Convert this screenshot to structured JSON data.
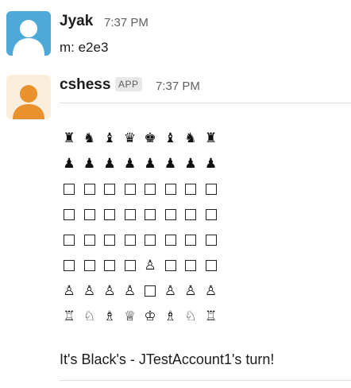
{
  "messages": [
    {
      "author": "Jyak",
      "time": "7:37 PM",
      "text": "m: e2e3",
      "avatar_color": "#4ea8d8"
    },
    {
      "author": "cshess",
      "badge": "APP",
      "time": "7:37 PM",
      "avatar_color": "#e8912d",
      "board": [
        [
          "♜",
          "♞",
          "♝",
          "♛",
          "♚",
          "♝",
          "♞",
          "♜"
        ],
        [
          "♟",
          "♟",
          "♟",
          "♟",
          "♟",
          "♟",
          "♟",
          "♟"
        ],
        [
          "",
          "",
          "",
          "",
          "",
          "",
          "",
          ""
        ],
        [
          "",
          "",
          "",
          "",
          "",
          "",
          "",
          ""
        ],
        [
          "",
          "",
          "",
          "",
          "",
          "",
          "",
          ""
        ],
        [
          "",
          "",
          "",
          "",
          "♙",
          "",
          "",
          ""
        ],
        [
          "♙",
          "♙",
          "♙",
          "♙",
          "",
          "♙",
          "♙",
          "♙"
        ],
        [
          "♖",
          "♘",
          "♗",
          "♕",
          "♔",
          "♗",
          "♘",
          "♖"
        ]
      ],
      "footer_text": "It's Black's - JTestAccount1's turn!"
    }
  ]
}
